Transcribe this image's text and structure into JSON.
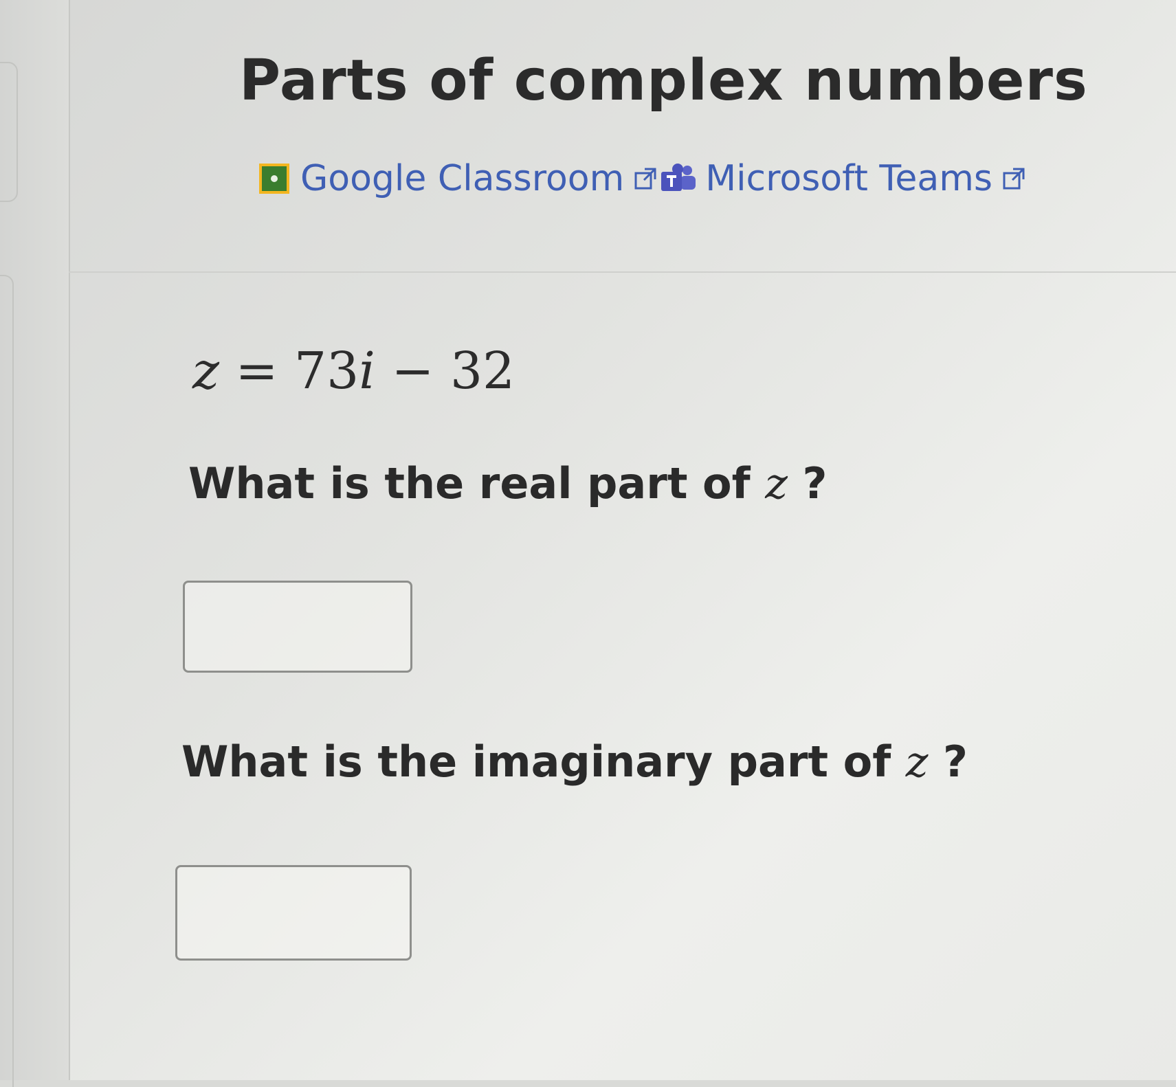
{
  "page": {
    "title": "Parts of complex numbers"
  },
  "share": {
    "google_classroom_label": "Google Classroom",
    "microsoft_teams_label": "Microsoft Teams"
  },
  "problem": {
    "equation_lhs": "z",
    "equation_rhs": "= 73",
    "equation_i": "i",
    "equation_tail": " − 32",
    "q1_text": "What is the real part of ",
    "q1_var": "z",
    "q1_end": " ?",
    "q2_text": "What is the imaginary part of ",
    "q2_var": "z",
    "q2_end": " ?",
    "answer1_value": "",
    "answer2_value": ""
  },
  "colors": {
    "link": "#3f5fb4",
    "google_classroom_green": "#3a7d2e",
    "google_classroom_yellow": "#f3b61f",
    "teams_purple": "#4b53bc"
  }
}
